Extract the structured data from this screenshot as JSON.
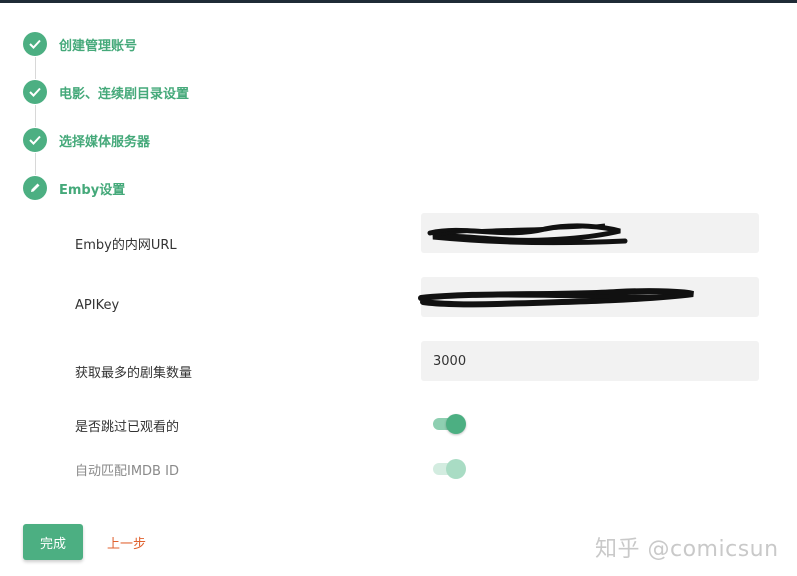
{
  "steps": [
    {
      "label": "创建管理账号",
      "icon": "check-icon"
    },
    {
      "label": "电影、连续剧目录设置",
      "icon": "check-icon"
    },
    {
      "label": "选择媒体服务器",
      "icon": "check-icon"
    },
    {
      "label": "Emby设置",
      "icon": "pencil-icon"
    }
  ],
  "form": {
    "url_label": "Emby的内网URL",
    "apikey_label": "APIKey",
    "max_episodes_label": "获取最多的剧集数量",
    "max_episodes_value": "3000",
    "skip_watched_label": "是否跳过已观看的",
    "skip_watched_on": true,
    "auto_imdb_label": "自动匹配IMDB ID",
    "auto_imdb_on": true,
    "auto_imdb_disabled": true
  },
  "actions": {
    "done_label": "完成",
    "prev_label": "上一步"
  },
  "watermark": "知乎 @comicsun",
  "colors": {
    "accent": "#4caf82",
    "accent_text": "#45a97a",
    "prev_link": "#e0622f",
    "field_bg": "#f2f2f2"
  }
}
